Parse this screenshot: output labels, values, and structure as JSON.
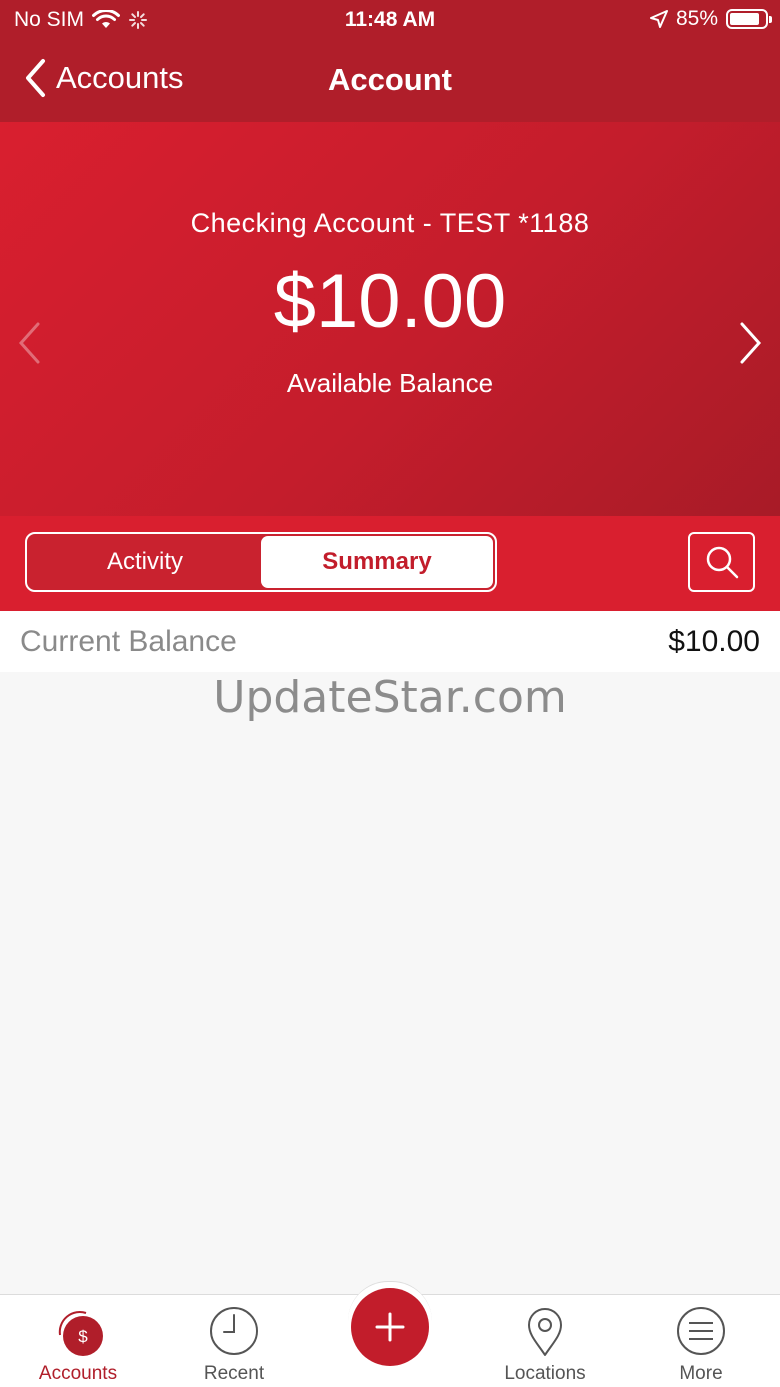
{
  "status_bar": {
    "carrier": "No SIM",
    "time": "11:48 AM",
    "battery_text": "85%",
    "battery_level": 0.85
  },
  "nav": {
    "back_label": "Accounts",
    "title": "Account"
  },
  "hero": {
    "account_name": "Checking Account - TEST *1188",
    "amount": "$10.00",
    "amount_label": "Available Balance"
  },
  "tabs": [
    {
      "label": "Activity",
      "active": false
    },
    {
      "label": "Summary",
      "active": true
    }
  ],
  "summary": {
    "rows": [
      {
        "label": "Current Balance",
        "value": "$10.00"
      }
    ]
  },
  "watermark": "UpdateStar.com",
  "tab_bar": {
    "items": [
      {
        "label": "Accounts",
        "icon": "accounts-icon",
        "active": true
      },
      {
        "label": "Recent",
        "icon": "clock-icon",
        "active": false
      },
      {
        "label": "Locations",
        "icon": "location-pin-icon",
        "active": false
      },
      {
        "label": "More",
        "icon": "menu-icon",
        "active": false
      }
    ],
    "fab_icon": "plus-icon"
  },
  "colors": {
    "brand_dark": "#b01e2a",
    "brand": "#d91f2f",
    "accent_text": "#c21d2b"
  }
}
